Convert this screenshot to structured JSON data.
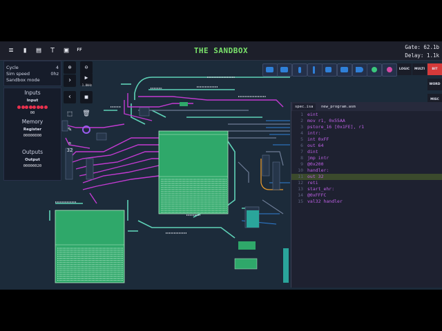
{
  "app": {
    "title": "THE SANDBOX"
  },
  "toolbar_left": [
    {
      "name": "menu-icon",
      "glyph": "≡"
    },
    {
      "name": "file-icon",
      "glyph": "▮"
    },
    {
      "name": "document-icon",
      "glyph": "▤"
    },
    {
      "name": "hierarchy-icon",
      "glyph": "⊤"
    },
    {
      "name": "chip-icon",
      "glyph": "▣"
    },
    {
      "name": "fast-forward-label",
      "glyph": "FF"
    }
  ],
  "stats": {
    "gate": "Gate: 62.1b",
    "delay": "Delay: 1.1k"
  },
  "info_panel": {
    "cycle_label": "Cycle",
    "cycle_value": "4",
    "sim_speed_label": "Sim speed",
    "sim_speed_value": "0hz",
    "mode": "Sandbox mode"
  },
  "io_panel": {
    "inputs_title": "Inputs",
    "input_label": "Input",
    "input_value": "00",
    "memory_title": "Memory",
    "register_label": "Register",
    "register_value": "00000000",
    "outputs_title": "Outputs",
    "output_label": "Output",
    "output_value": "00000020"
  },
  "sim_controls": {
    "rate": "1.0kHz",
    "bits": "32"
  },
  "category_buttons": [
    "LOGIC",
    "MULTI",
    "BIT",
    "WORD",
    "MISC"
  ],
  "editor": {
    "tabs": [
      "spec.isa",
      "new_program.asm"
    ],
    "lines": [
      {
        "n": "1",
        "text": "eint"
      },
      {
        "n": "2",
        "text": "mov r1, 0x55AA"
      },
      {
        "n": "3",
        "text": "pstore_16 [0x1FE], r1"
      },
      {
        "n": "4",
        "text": "intr:"
      },
      {
        "n": "5",
        "text": "int 0xFF"
      },
      {
        "n": "6",
        "text": "out 64"
      },
      {
        "n": "7",
        "text": "dint"
      },
      {
        "n": "8",
        "text": "jmp intr"
      },
      {
        "n": "9",
        "text": "@0x200"
      },
      {
        "n": "10",
        "text": "handler:"
      },
      {
        "n": "11",
        "text": "out 32"
      },
      {
        "n": "12",
        "text": "reti"
      },
      {
        "n": "13",
        "text": "start_ehr:"
      },
      {
        "n": "14",
        "text": "@0xFFFC"
      },
      {
        "n": "15",
        "text": "val32 handler"
      }
    ],
    "highlight_line": 11
  },
  "colors": {
    "title_green": "#7be36b",
    "led_red": "#e8314e",
    "wire_magenta": "#c33bd2",
    "wire_teal": "#5fd3b8",
    "chip_green": "#2fa86a",
    "code_purple": "#c061e8"
  }
}
